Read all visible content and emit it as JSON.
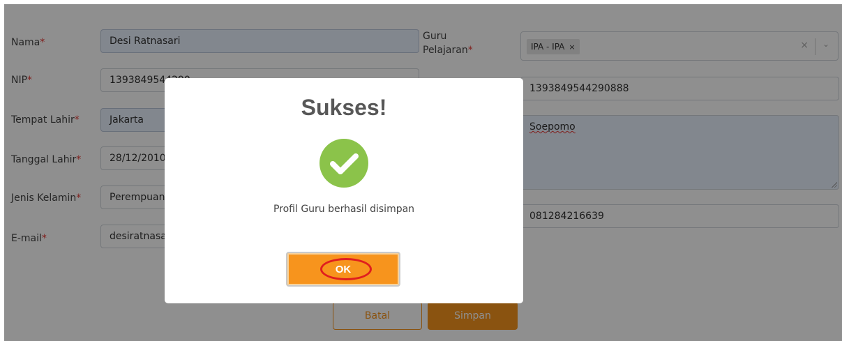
{
  "form": {
    "required_mark": "*",
    "nama": {
      "label": "Nama",
      "value": "Desi Ratnasari"
    },
    "nip": {
      "label": "NIP",
      "value": "1393849544290"
    },
    "tempat_lahir": {
      "label": "Tempat Lahir",
      "value": "Jakarta"
    },
    "tanggal_lahir": {
      "label": "Tanggal Lahir",
      "value": "28/12/2010"
    },
    "jenis_kelamin": {
      "label": "Jenis Kelamin",
      "value": "Perempuan"
    },
    "email": {
      "label": "E-mail",
      "value": "desiratnasari"
    },
    "guru_pelajaran": {
      "label_line1": "Guru",
      "label_line2": "Pelajaran",
      "selected_tag": "IPA - IPA",
      "tag_remove": "×",
      "clear": "×",
      "chevron": "⌄"
    },
    "right_field_1": {
      "value": "1393849544290888"
    },
    "right_textarea": {
      "value": "Soepomo"
    },
    "right_field_3": {
      "value": "081284216639"
    }
  },
  "buttons": {
    "batal": "Batal",
    "simpan": "Simpan"
  },
  "modal": {
    "title": "Sukses!",
    "message": "Profil Guru berhasil disimpan",
    "ok": "OK",
    "icon": "success-check-icon"
  },
  "colors": {
    "accent": "#f7941d",
    "success": "#8bc34a",
    "annotation": "#e01e1e"
  }
}
